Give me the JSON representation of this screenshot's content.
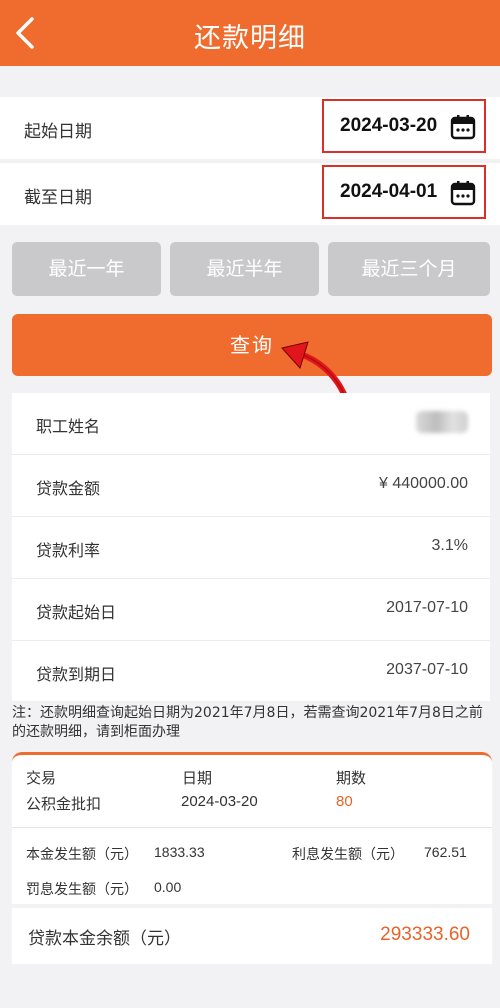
{
  "header": {
    "title": "还款明细",
    "back_icon": "chevron-left-icon"
  },
  "filters": {
    "start": {
      "label": "起始日期",
      "value": "2024-03-20",
      "icon": "calendar-icon"
    },
    "end": {
      "label": "截至日期",
      "value": "2024-04-01",
      "icon": "calendar-icon"
    }
  },
  "quick_ranges": [
    "最近一年",
    "最近半年",
    "最近三个月"
  ],
  "query_button": "查询",
  "loan_info": {
    "name_label": "职工姓名",
    "amount_label": "贷款金额",
    "amount_value": "¥ 440000.00",
    "rate_label": "贷款利率",
    "rate_value": "3.1%",
    "start_label": "贷款起始日",
    "start_value": "2017-07-10",
    "end_label": "贷款到期日",
    "end_value": "2037-07-10"
  },
  "note": "注：还款明细查询起始日期为2021年7月8日，若需查询2021年7月8日之前的还款明细，请到柜面办理",
  "record": {
    "type_header": "交易",
    "date_header": "日期",
    "period_header": "期数",
    "type": "公积金批扣",
    "date": "2024-03-20",
    "period": "80",
    "principal_label": "本金发生额（元）",
    "principal_value": "1833.33",
    "interest_label": "利息发生额（元）",
    "interest_value": "762.51",
    "penalty_label": "罚息发生额（元）",
    "penalty_value": "0.00"
  },
  "balance": {
    "label": "贷款本金余额（元）",
    "value": "293333.60"
  },
  "colors": {
    "accent": "#ef6b2e",
    "highlight_border": "#d9302a",
    "button_disabled": "#c9c9cb"
  }
}
